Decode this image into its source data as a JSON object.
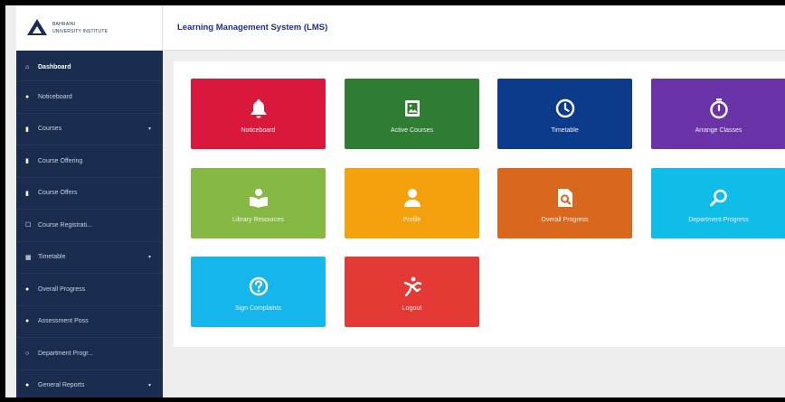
{
  "app": {
    "logo_lines": [
      "BAHRAINI",
      "UNIVERSITY INSTITUTE"
    ],
    "title": "Learning Management System (LMS)"
  },
  "sidebar": {
    "items": [
      {
        "label": "Dashboard",
        "icon": "home-icon",
        "glyph": "⌂",
        "active": true,
        "caret": false
      },
      {
        "label": "Noticeboard",
        "icon": "bell-icon",
        "glyph": "●",
        "active": false,
        "caret": false
      },
      {
        "label": "Courses",
        "icon": "book-icon",
        "glyph": "▮",
        "active": false,
        "caret": true
      },
      {
        "label": "Course Offering",
        "icon": "book-icon",
        "glyph": "▮",
        "active": false,
        "caret": false
      },
      {
        "label": "Course Offers",
        "icon": "book-icon",
        "glyph": "▮",
        "active": false,
        "caret": false
      },
      {
        "label": "Course Registrati...",
        "icon": "clipboard-icon",
        "glyph": "☐",
        "active": false,
        "caret": false
      },
      {
        "label": "Timetable",
        "icon": "calendar-icon",
        "glyph": "▦",
        "active": false,
        "caret": true
      },
      {
        "label": "Overall Progress",
        "icon": "chart-icon",
        "glyph": "●",
        "active": false,
        "caret": false
      },
      {
        "label": "Assessment Poss",
        "icon": "circle-icon",
        "glyph": "●",
        "active": false,
        "caret": false
      },
      {
        "label": "Department Progr...",
        "icon": "clock-icon",
        "glyph": "○",
        "active": false,
        "caret": false
      },
      {
        "label": "General Reports",
        "icon": "circle-icon",
        "glyph": "●",
        "active": false,
        "caret": true
      }
    ],
    "caret_glyph": "▾"
  },
  "tiles": [
    {
      "label": "Noticeboard",
      "icon": "bell-icon",
      "color": "#d9183b"
    },
    {
      "label": "Active Courses",
      "icon": "image-icon",
      "color": "#2e7d32"
    },
    {
      "label": "Timetable",
      "icon": "clock-icon",
      "color": "#0d3b8c"
    },
    {
      "label": "Arrange Classes",
      "icon": "stopwatch-icon",
      "color": "#6a33a8"
    },
    {
      "label": "Library Resources",
      "icon": "reading-icon",
      "color": "#85b943"
    },
    {
      "label": "Profile",
      "icon": "user-icon",
      "color": "#f5a10e"
    },
    {
      "label": "Overall Progress",
      "icon": "search-document-icon",
      "color": "#d9671e"
    },
    {
      "label": "Department Progress",
      "icon": "search-icon",
      "color": "#0fbde8"
    },
    {
      "label": "Sign Complaints",
      "icon": "question-icon",
      "color": "#14b6ec"
    },
    {
      "label": "Logout",
      "icon": "logout-icon",
      "color": "#e53935"
    }
  ]
}
